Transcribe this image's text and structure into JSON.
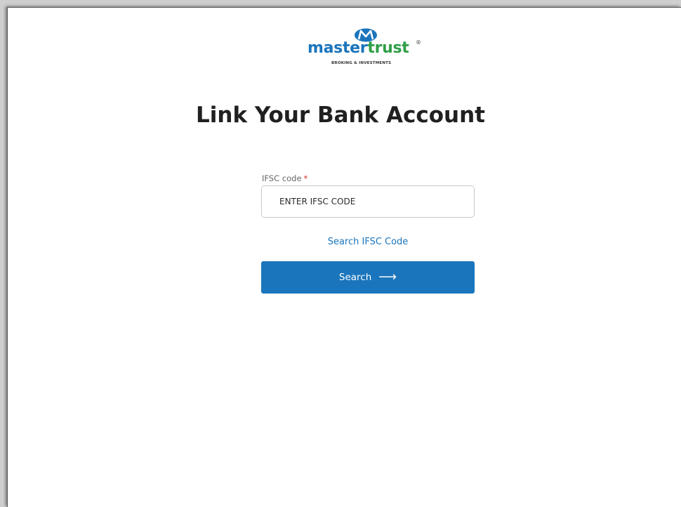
{
  "logo": {
    "word_part1": "master",
    "word_part2": "trust",
    "registered": "®",
    "tagline": "BROKING & INVESTMENTS",
    "icon": "mastertrust-m-icon"
  },
  "page": {
    "title": "Link Your Bank Account"
  },
  "form": {
    "ifsc_label": "IFSC code",
    "required_marker": "*",
    "ifsc_placeholder": "ENTER IFSC CODE",
    "ifsc_value": "",
    "search_link": "Search IFSC Code",
    "search_button": "Search",
    "search_button_icon": "arrow-right-icon"
  },
  "colors": {
    "brand_blue": "#1a75bc",
    "brand_green": "#2e9e47",
    "required_red": "#d32f2f"
  }
}
